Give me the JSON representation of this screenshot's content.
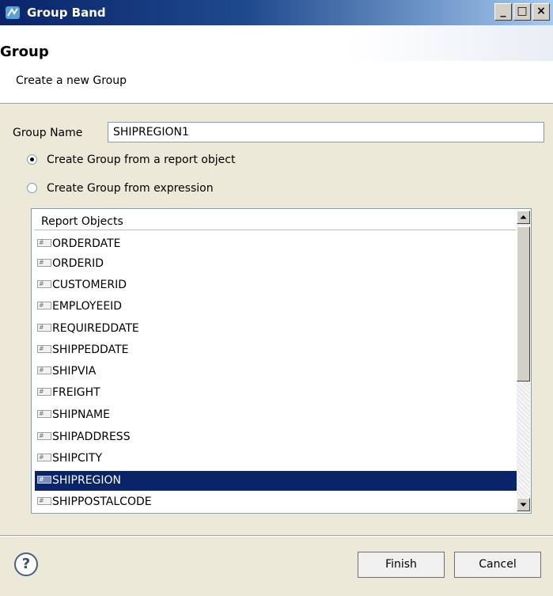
{
  "window": {
    "title": "Group Band",
    "controls": {
      "minimize": "_",
      "maximize": "□",
      "close": "×"
    }
  },
  "header": {
    "title": "Group",
    "description": "Create a new Group"
  },
  "form": {
    "group_name_label": "Group Name",
    "group_name_value": "SHIPREGION1",
    "options": [
      {
        "label": "Create Group from a report object",
        "checked": true
      },
      {
        "label": "Create Group from expression",
        "checked": false
      }
    ]
  },
  "report_objects": {
    "header": "Report Objects",
    "items": [
      {
        "label": "ORDERDATE",
        "selected": false
      },
      {
        "label": "ORDERID",
        "selected": false
      },
      {
        "label": "CUSTOMERID",
        "selected": false
      },
      {
        "label": "EMPLOYEEID",
        "selected": false
      },
      {
        "label": "REQUIREDDATE",
        "selected": false
      },
      {
        "label": "SHIPPEDDATE",
        "selected": false
      },
      {
        "label": "SHIPVIA",
        "selected": false
      },
      {
        "label": "FREIGHT",
        "selected": false
      },
      {
        "label": "SHIPNAME",
        "selected": false
      },
      {
        "label": "SHIPADDRESS",
        "selected": false
      },
      {
        "label": "SHIPCITY",
        "selected": false
      },
      {
        "label": "SHIPREGION",
        "selected": true
      },
      {
        "label": "SHIPPOSTALCODE",
        "selected": false
      }
    ],
    "field_icon_glyph": "#"
  },
  "footer": {
    "help_glyph": "?",
    "finish_label": "Finish",
    "cancel_label": "Cancel"
  },
  "colors": {
    "selection": "#0A246A",
    "titlebar": "#0A246A"
  }
}
